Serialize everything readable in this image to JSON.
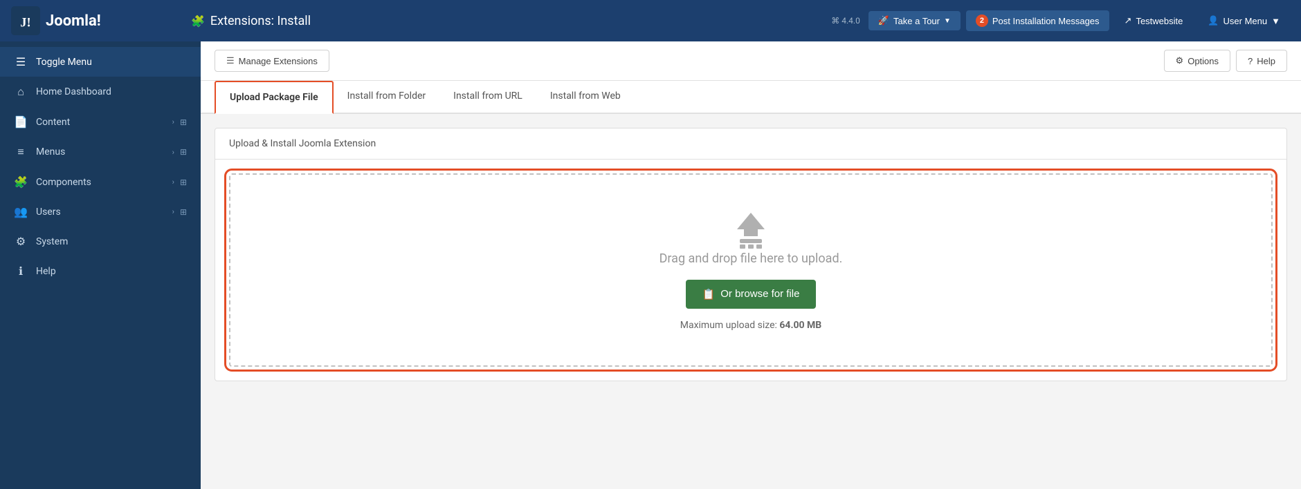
{
  "topbar": {
    "logo_text": "Joomla!",
    "page_title": "Extensions: Install",
    "version": "⌘ 4.4.0",
    "take_tour_label": "Take a Tour",
    "notifications_count": "2",
    "post_install_label": "Post Installation Messages",
    "testwebsite_label": "Testwebsite",
    "user_menu_label": "User Menu"
  },
  "toolbar": {
    "manage_extensions_label": "Manage Extensions",
    "options_label": "Options",
    "help_label": "Help"
  },
  "tabs": [
    {
      "id": "upload",
      "label": "Upload Package File",
      "active": true
    },
    {
      "id": "folder",
      "label": "Install from Folder",
      "active": false
    },
    {
      "id": "url",
      "label": "Install from URL",
      "active": false
    },
    {
      "id": "web",
      "label": "Install from Web",
      "active": false
    }
  ],
  "upload": {
    "section_title": "Upload & Install Joomla Extension",
    "drag_drop_text": "Drag and drop file here to upload.",
    "browse_label": "Or browse for file",
    "max_size_prefix": "Maximum upload size: ",
    "max_size_value": "64.00 MB"
  },
  "sidebar": {
    "items": [
      {
        "id": "toggle",
        "label": "Toggle Menu",
        "icon": "☰",
        "has_chevron": false,
        "has_grid": false
      },
      {
        "id": "home",
        "label": "Home Dashboard",
        "icon": "⌂",
        "has_chevron": false,
        "has_grid": false
      },
      {
        "id": "content",
        "label": "Content",
        "icon": "📄",
        "has_chevron": true,
        "has_grid": true
      },
      {
        "id": "menus",
        "label": "Menus",
        "icon": "≡",
        "has_chevron": true,
        "has_grid": true
      },
      {
        "id": "components",
        "label": "Components",
        "icon": "🧩",
        "has_chevron": true,
        "has_grid": true
      },
      {
        "id": "users",
        "label": "Users",
        "icon": "👥",
        "has_chevron": true,
        "has_grid": true
      },
      {
        "id": "system",
        "label": "System",
        "icon": "⚙",
        "has_chevron": false,
        "has_grid": false
      },
      {
        "id": "help",
        "label": "Help",
        "icon": "ℹ",
        "has_chevron": false,
        "has_grid": false
      }
    ]
  }
}
